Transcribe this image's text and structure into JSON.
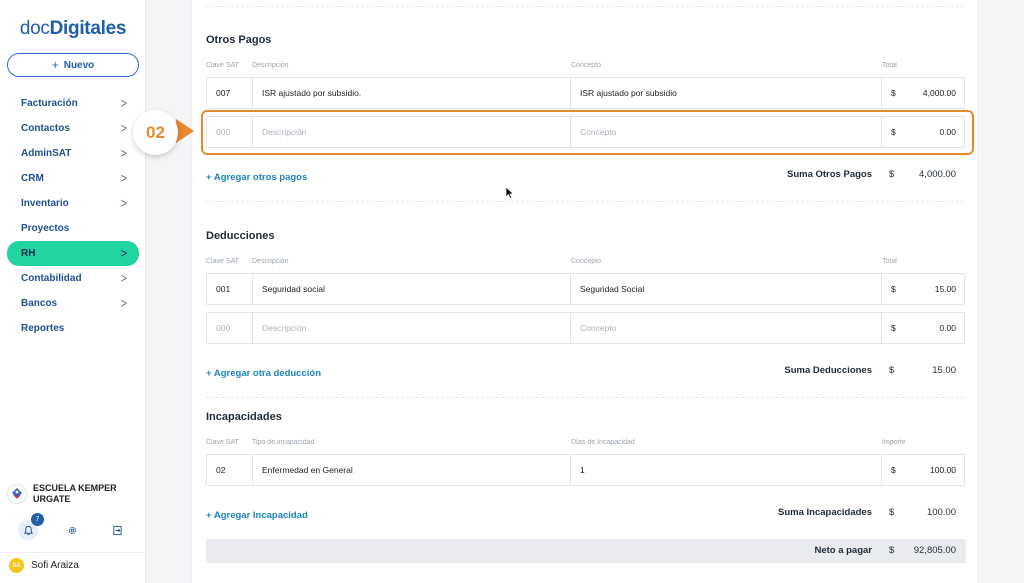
{
  "app": {
    "logo_doc": "doc",
    "logo_digitales": "Digitales",
    "new_button": "Nuevo"
  },
  "sidebar": {
    "items": [
      {
        "label": "Facturación",
        "chevron": true
      },
      {
        "label": "Contactos",
        "chevron": true
      },
      {
        "label": "AdminSAT",
        "chevron": true
      },
      {
        "label": "CRM",
        "chevron": true
      },
      {
        "label": "Inventario",
        "chevron": true
      },
      {
        "label": "Proyectos",
        "chevron": false
      },
      {
        "label": "RH",
        "chevron": true,
        "active": true
      },
      {
        "label": "Contabilidad",
        "chevron": true
      },
      {
        "label": "Bancos",
        "chevron": true
      },
      {
        "label": "Reportes",
        "chevron": false
      }
    ],
    "company_name": "ESCUELA KEMPER URGATE",
    "notifications_count": "7",
    "user_initials": "SA",
    "user_name": "Sofi Araiza"
  },
  "otros_pagos": {
    "title": "Otros Pagos",
    "headers": {
      "clave": "Clave SAT",
      "descripcion": "Descripción",
      "concepto": "Concepto",
      "total": "Total"
    },
    "rows": [
      {
        "clave": "007",
        "descripcion": "ISR ajustado por subsidio.",
        "concepto": "ISR ajustado por subsidio",
        "cur": "$",
        "total": "4,000.00"
      }
    ],
    "new_row": {
      "clave": "000",
      "descripcion": "Descripción",
      "concepto": "Concepto",
      "cur": "$",
      "total": "0.00"
    },
    "add_link": "+ Agregar otros pagos",
    "sum_label": "Suma Otros Pagos",
    "sum_cur": "$",
    "sum_value": "4,000.00"
  },
  "deducciones": {
    "title": "Deducciones",
    "headers": {
      "clave": "Clave SAT",
      "descripcion": "Descripción",
      "concepto": "Concepto",
      "total": "Total"
    },
    "rows": [
      {
        "clave": "001",
        "descripcion": "Seguridad social",
        "concepto": "Seguridad Social",
        "cur": "$",
        "total": "15.00"
      }
    ],
    "new_row": {
      "clave": "000",
      "descripcion": "Descripción",
      "concepto": "Concepto",
      "cur": "$",
      "total": "0.00"
    },
    "add_link": "+ Agregar otra deducción",
    "sum_label": "Suma Deducciones",
    "sum_cur": "$",
    "sum_value": "15.00"
  },
  "incapacidades": {
    "title": "Incapacidades",
    "headers": {
      "clave": "Clave SAT",
      "tipo": "Tipo de incapacidad",
      "dias": "Días de Incapacidad",
      "importe": "Importe"
    },
    "rows": [
      {
        "clave": "02",
        "tipo": "Enfermedad en General",
        "dias": "1",
        "cur": "$",
        "importe": "100.00"
      }
    ],
    "add_link": "+ Agregar Incapacidad",
    "sum_label": "Suma Incapacidades",
    "sum_cur": "$",
    "sum_value": "100.00"
  },
  "neto": {
    "label": "Neto a pagar",
    "cur": "$",
    "value": "92,805.00"
  },
  "annotation": {
    "step": "02",
    "color": "#e8892f"
  }
}
